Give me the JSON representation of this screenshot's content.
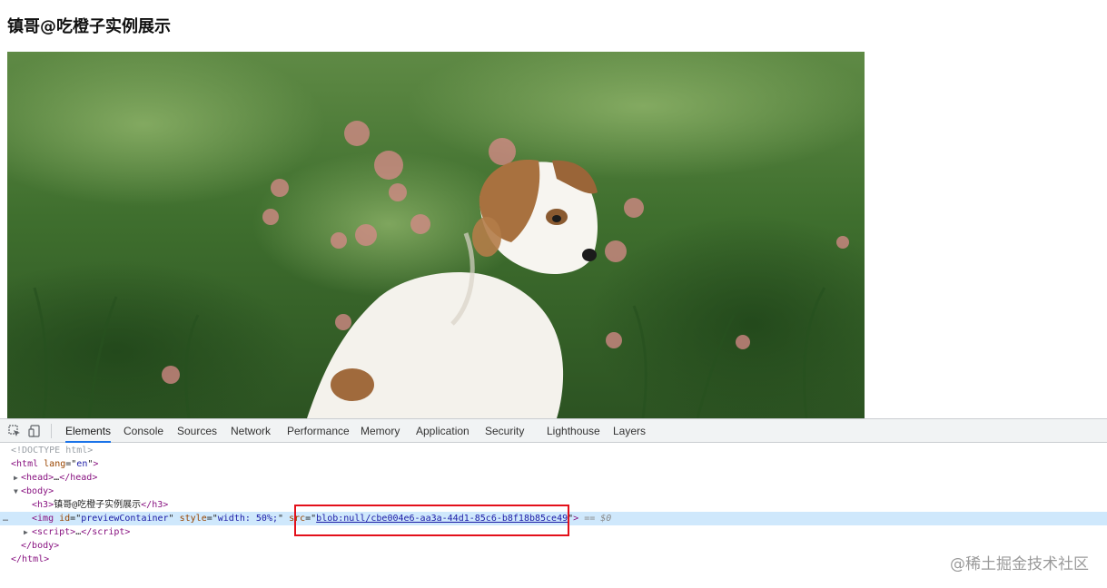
{
  "page": {
    "heading": "镇哥@吃橙子实例展示",
    "image_alt": "puppy in flower field"
  },
  "devtools": {
    "toolbar_icons": [
      "inspect-element-icon",
      "device-toolbar-icon"
    ],
    "tabs": [
      {
        "label": "Elements",
        "active": true
      },
      {
        "label": "Console"
      },
      {
        "label": "Sources"
      },
      {
        "label": "Network"
      },
      {
        "label": "Performance"
      },
      {
        "label": "Memory"
      },
      {
        "label": "Application"
      },
      {
        "label": "Security"
      },
      {
        "label": "Lighthouse"
      },
      {
        "label": "Layers"
      }
    ],
    "dom": {
      "doctype": "<!DOCTYPE html>",
      "html_open_tag": "html",
      "html_attr_name": "lang",
      "html_attr_value": "en",
      "head_tag": "head",
      "ellipsis": "…",
      "body_tag": "body",
      "h3_tag": "h3",
      "h3_text": "镇哥@吃橙子实例展示",
      "img_tag": "img",
      "img_id_attr": "id",
      "img_id_value": "previewContainer",
      "img_style_attr": "style",
      "img_style_value": "width: 50%;",
      "img_src_attr": "src",
      "img_src_value": "blob:null/cbe004e6-aa3a-44d1-85c6-b8f18b85ce49",
      "selected_marker": "== $0",
      "script_tag": "script",
      "row_dots": "…"
    }
  },
  "watermark": "@稀土掘金技术社区",
  "colors": {
    "highlight_box": "#e3101a",
    "selected_row": "#cfe8fc",
    "tab_active_underline": "#1a73e8"
  }
}
